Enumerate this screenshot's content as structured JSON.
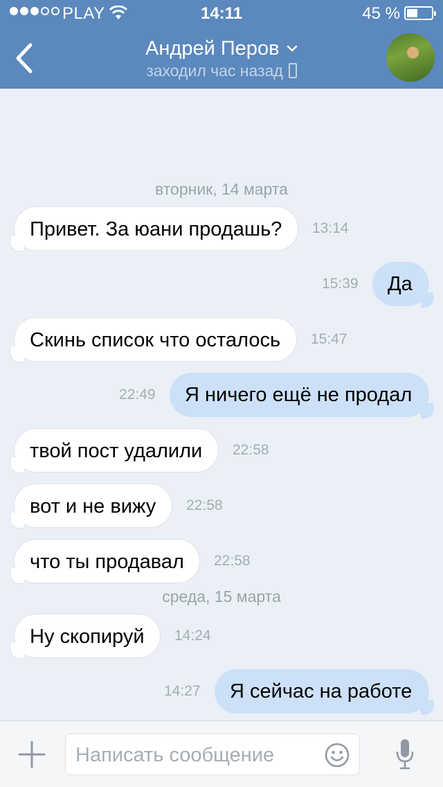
{
  "status_bar": {
    "carrier": "PLAY",
    "time": "14:11",
    "battery_percent": "45 %",
    "battery_level": 0.45,
    "signal_bars": 3
  },
  "header": {
    "contact_name": "Андрей Перов",
    "last_seen": "заходил час назад",
    "colors": {
      "bar": "#5b88bd"
    }
  },
  "messages": [
    {
      "type": "date",
      "text": "вторник, 14 марта"
    },
    {
      "type": "in",
      "text": "Привет. За юани продашь?",
      "time": "13:14"
    },
    {
      "type": "out",
      "text": "Да",
      "time": "15:39"
    },
    {
      "type": "in",
      "text": "Скинь список что осталось",
      "time": "15:47"
    },
    {
      "type": "out",
      "text": "Я ничего ещё не продал",
      "time": "22:49"
    },
    {
      "type": "in",
      "text": "твой пост удалили",
      "time": "22:58"
    },
    {
      "type": "in",
      "text": "вот и не вижу",
      "time": "22:58"
    },
    {
      "type": "in",
      "text": "что ты продавал",
      "time": "22:58"
    },
    {
      "type": "date",
      "text": "среда, 15 марта"
    },
    {
      "type": "in",
      "text": "Ну скопируй",
      "time": "14:24"
    },
    {
      "type": "out",
      "text": "Я сейчас на работе",
      "time": "14:27"
    }
  ],
  "composer": {
    "placeholder": "Написать сообщение",
    "value": ""
  },
  "colors": {
    "background": "#ebf0f6",
    "incoming_bubble": "#ffffff",
    "outgoing_bubble": "#cce0f8"
  }
}
